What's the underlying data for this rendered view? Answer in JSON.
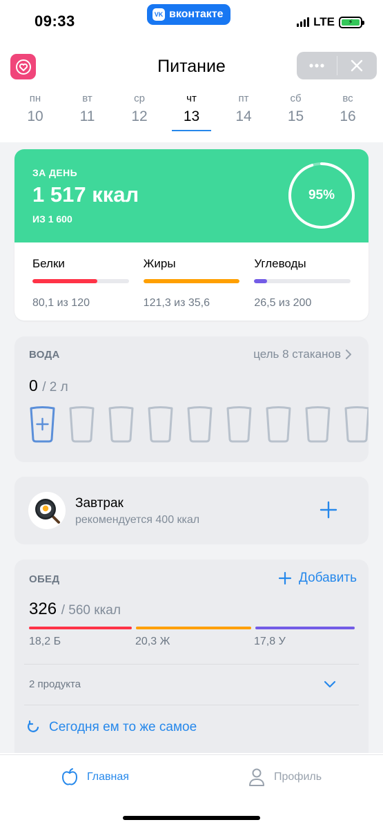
{
  "status_bar": {
    "time": "09:33",
    "app_badge": "вконтакте",
    "network": "LTE",
    "signal_icon": "signal-icon",
    "battery_icon": "battery-charging-icon"
  },
  "header": {
    "title": "Питание",
    "app_icon": "heart-icon",
    "more_icon": "more-horizontal-icon",
    "close_icon": "close-icon"
  },
  "days": [
    {
      "weekday": "пн",
      "date": "10"
    },
    {
      "weekday": "вт",
      "date": "11"
    },
    {
      "weekday": "ср",
      "date": "12"
    },
    {
      "weekday": "чт",
      "date": "13",
      "active": true
    },
    {
      "weekday": "пт",
      "date": "14"
    },
    {
      "weekday": "сб",
      "date": "15"
    },
    {
      "weekday": "вс",
      "date": "16"
    }
  ],
  "summary": {
    "label": "ЗА ДЕНЬ",
    "calories": "1 517 ккал",
    "of_total": "ИЗ 1 600",
    "percent_text": "95%",
    "percent": 95,
    "macros": [
      {
        "name": "Белки",
        "value": "80,1 из 120",
        "fill": 0.67,
        "color": "#ff3347"
      },
      {
        "name": "Жиры",
        "value": "121,3 из 35,6",
        "fill": 1.0,
        "color": "#ffa000"
      },
      {
        "name": "Углеводы",
        "value": "26,5 из 200",
        "fill": 0.13,
        "color": "#735ce6"
      }
    ]
  },
  "water": {
    "title": "ВОДА",
    "goal": "цель 8 стаканов",
    "amount": "0",
    "of": "/ 2 л",
    "glasses_total": 9,
    "glasses_filled": 0
  },
  "breakfast": {
    "title": "Завтрак",
    "subtitle": "рекомендуется 400 ккал",
    "icon": "fried-egg-pan-icon"
  },
  "lunch": {
    "title": "ОБЕД",
    "add_label": "Добавить",
    "kcal": "326",
    "kcal_of": "/ 560 ккал",
    "macros": [
      {
        "label": "18,2 Б",
        "color": "#ff3347"
      },
      {
        "label": "20,3 Ж",
        "color": "#ffa000"
      },
      {
        "label": "17,8 У",
        "color": "#735ce6"
      }
    ],
    "products": "2 продукта",
    "repeat_label": "Сегодня ем то же самое"
  },
  "tabbar": {
    "home": "Главная",
    "profile": "Профиль"
  },
  "colors": {
    "accent": "#2688eb",
    "green": "#3fd89a",
    "protein": "#ff3347",
    "fat": "#ffa000",
    "carbs": "#735ce6"
  }
}
